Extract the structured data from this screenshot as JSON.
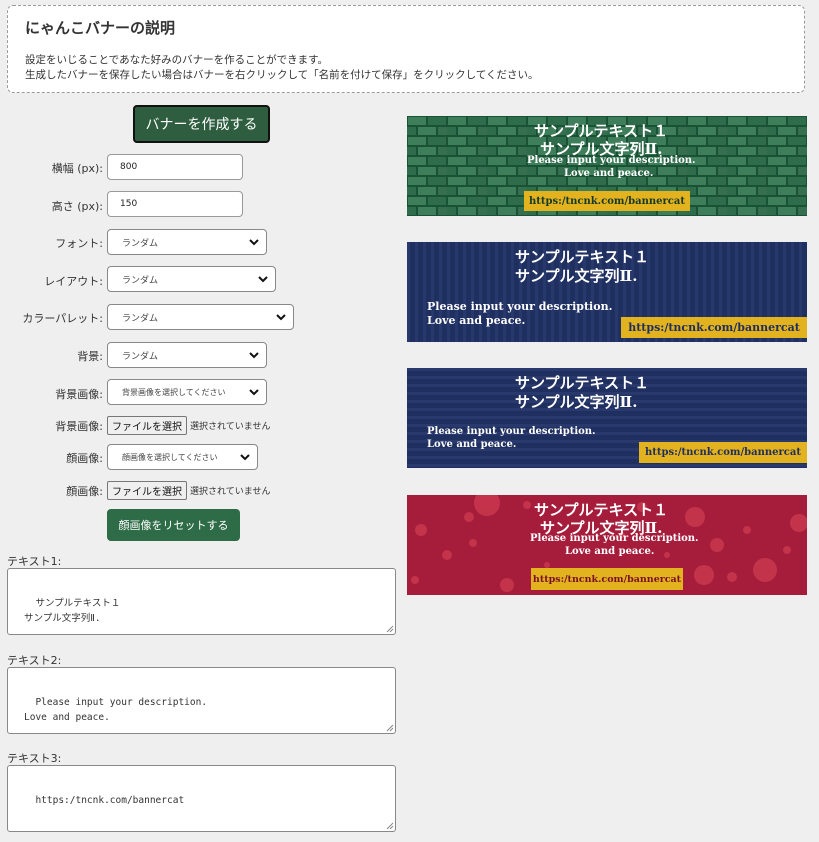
{
  "info": {
    "title": "にゃんこバナーの説明",
    "line1": "設定をいじることであなた好みのバナーを作ることができます。",
    "line2": "生成したバナーを保存したい場合はバナーを右クリックして「名前を付けて保存」をクリックしてください。"
  },
  "form": {
    "create_label": "バナーを作成する",
    "width_label": "横幅 (px):",
    "width_value": "800",
    "height_label": "高さ (px):",
    "height_value": "150",
    "font_label": "フォント:",
    "font_value": "ランダム",
    "layout_label": "レイアウト:",
    "layout_value": "ランダム",
    "palette_label": "カラーパレット:",
    "palette_value": "ランダム",
    "bg_label": "背景:",
    "bg_value": "ランダム",
    "bgimg_label": "背景画像:",
    "bgimg_value": "背景画像を選択してください",
    "bgfile_label": "背景画像:",
    "face_label": "顔画像:",
    "face_value": "顔画像を選択してください",
    "facefile_label": "顔画像:",
    "file_button": "ファイルを選択",
    "file_none": "選択されていません",
    "reset_label": "顔画像をリセットする",
    "text1_label": "テキスト1:",
    "text1_value": "サンプルテキスト１\nサンプル文字列Ⅱ.",
    "text2_label": "テキスト2:",
    "text2_value": "Please input your description.\nLove and peace.",
    "text3_label": "テキスト3:",
    "text3_value": "https:/tncnk.com/bannercat"
  },
  "banners": {
    "title1": "サンプルテキスト１",
    "title2": "サンプル文字列Ⅱ.",
    "desc1": "Please input your description.",
    "desc2": "Love and peace.",
    "url": "https:/tncnk.com/bannercat"
  },
  "colors": {
    "green_button": "#2e5e3f",
    "banner_green": "#1d5a3b",
    "banner_navy": "#1f2f5f",
    "banner_red": "#a61d3c",
    "url_bg": "#e3b21f"
  }
}
